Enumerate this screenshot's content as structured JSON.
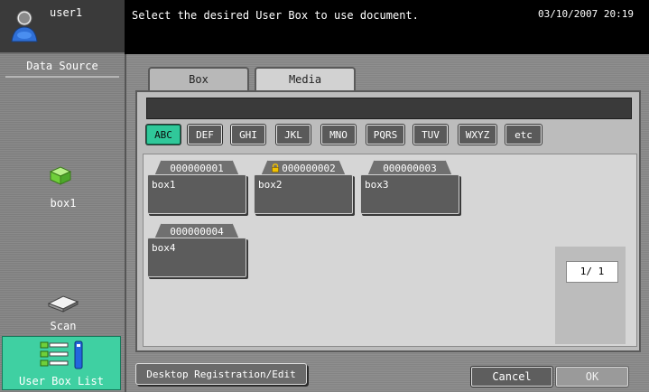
{
  "header": {
    "user_name": "user1",
    "message": "Select the desired User Box to use document.",
    "datetime": "03/10/2007 20:19"
  },
  "left_panel": {
    "data_source_label": "Data Source",
    "box_source_label": "box1",
    "scan_label": "Scan",
    "user_box_list_label": "User Box List"
  },
  "tabs": [
    {
      "label": "Box",
      "selected": true
    },
    {
      "label": "Media",
      "selected": false
    }
  ],
  "search": {
    "value": ""
  },
  "filters": [
    {
      "label": "ABC",
      "active": true
    },
    {
      "label": "DEF",
      "active": false
    },
    {
      "label": "GHI",
      "active": false
    },
    {
      "label": "JKL",
      "active": false
    },
    {
      "label": "MNO",
      "active": false
    },
    {
      "label": "PQRS",
      "active": false
    },
    {
      "label": "TUV",
      "active": false
    },
    {
      "label": "WXYZ",
      "active": false
    },
    {
      "label": "etc",
      "active": false
    }
  ],
  "boxes": [
    {
      "number": "000000001",
      "name": "box1",
      "locked": false
    },
    {
      "number": "000000002",
      "name": "box2",
      "locked": true
    },
    {
      "number": "000000003",
      "name": "box3",
      "locked": false
    },
    {
      "number": "000000004",
      "name": "box4",
      "locked": false
    }
  ],
  "pagination": {
    "readout": "1/ 1"
  },
  "actions": {
    "desktop_registration_label": "Desktop Registration/Edit",
    "cancel_label": "Cancel",
    "ok_label": "OK"
  },
  "colors": {
    "active_accent": "#30c89a",
    "panel_gray": "#8a8a8a",
    "box_dark": "#5c5c5c"
  },
  "icons": {
    "user": "user-avatar-icon",
    "box_source": "box-icon",
    "scan": "scanner-icon",
    "user_box_list": "user-box-list-icon",
    "lock": "lock-icon"
  }
}
